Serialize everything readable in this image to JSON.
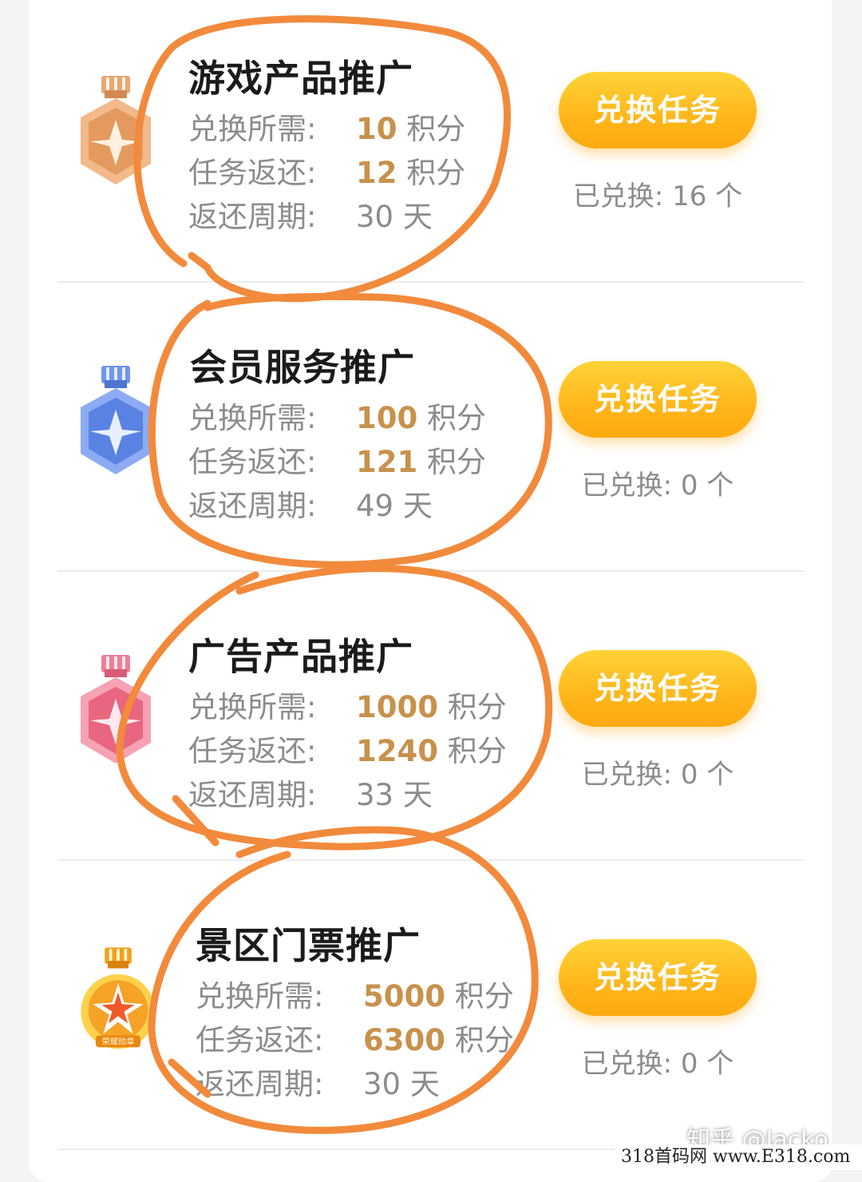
{
  "labels": {
    "cost": "兑换所需:",
    "return": "任务返还:",
    "period": "返还周期:",
    "points_unit": "积分",
    "day_unit": "天",
    "redeemed_prefix": "已兑换:",
    "count_unit": "个",
    "button": "兑换任务"
  },
  "tasks": [
    {
      "title": "游戏产品推广",
      "cost": "10",
      "return": "12",
      "period": "30",
      "redeemed": "16",
      "medal": "bronze-medal-icon",
      "medal_color": "#e8a36a"
    },
    {
      "title": "会员服务推广",
      "cost": "100",
      "return": "121",
      "period": "49",
      "redeemed": "0",
      "medal": "blue-medal-icon",
      "medal_color": "#5a86e6"
    },
    {
      "title": "广告产品推广",
      "cost": "1000",
      "return": "1240",
      "period": "33",
      "redeemed": "0",
      "medal": "pink-medal-icon",
      "medal_color": "#e86a86"
    },
    {
      "title": "景区门票推广",
      "cost": "5000",
      "return": "6300",
      "period": "30",
      "redeemed": "0",
      "medal": "gold-medal-icon",
      "medal_color": "#f39a1e",
      "medal_text": "荣耀勋章"
    }
  ],
  "watermarks": {
    "zhihu": "知乎 @Jacko",
    "site": "318首码网 www.E318.com"
  },
  "colors": {
    "accent_number": "#c8914c",
    "button": "#ffb61a",
    "annotation": "#f28a3c"
  }
}
